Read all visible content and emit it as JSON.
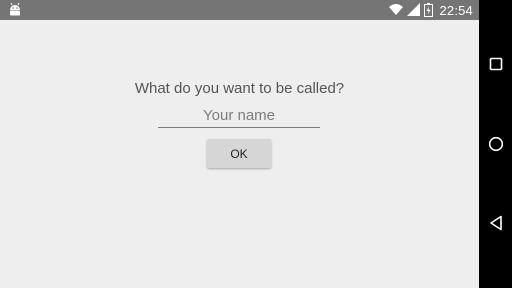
{
  "status_bar": {
    "time": "22:54",
    "icons": [
      "android-debug-icon",
      "wifi-icon",
      "signal-icon",
      "battery-icon"
    ]
  },
  "dialog": {
    "prompt": "What do you want to be called?",
    "name_placeholder": "Your name",
    "name_value": "",
    "ok_label": "OK"
  },
  "nav_bar": {
    "buttons": [
      "recents-icon",
      "home-icon",
      "back-icon"
    ]
  },
  "colors": {
    "status_bar_bg": "#757575",
    "screen_bg": "#eeeeee",
    "nav_bar_bg": "#000000",
    "button_bg": "#d6d6d6"
  }
}
